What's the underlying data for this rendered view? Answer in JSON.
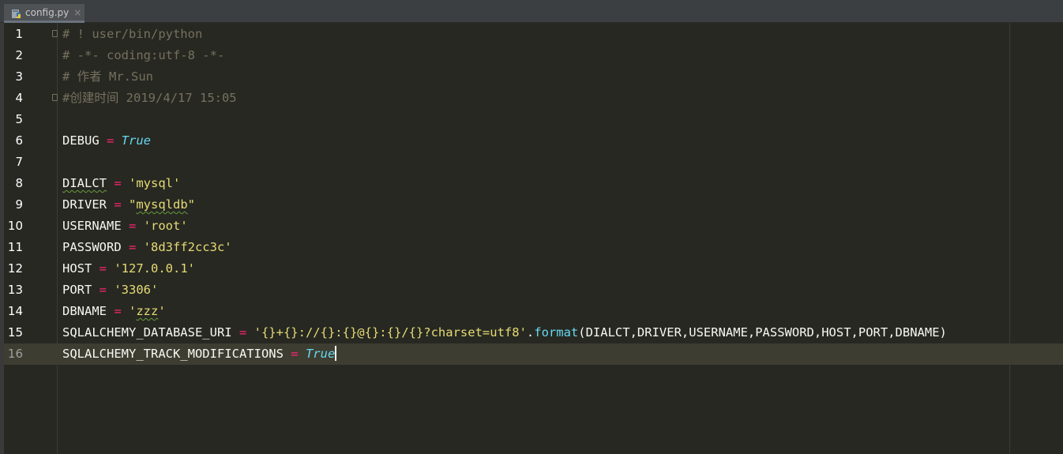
{
  "tab": {
    "label": "config.py",
    "close": "×",
    "icon": "python-file-icon"
  },
  "colors": {
    "background": "#272822",
    "comment": "#75715e",
    "operator": "#f92672",
    "constant": "#66d9ef",
    "string": "#e6db74",
    "text": "#f8f8f2",
    "current_line": "#3e3d32"
  },
  "lines": [
    {
      "n": "1",
      "fold": true,
      "tokens": [
        {
          "t": "# ! user/bin/python",
          "c": "comment"
        }
      ]
    },
    {
      "n": "2",
      "tokens": [
        {
          "t": "# -*- coding:utf-8 -*-",
          "c": "comment"
        }
      ]
    },
    {
      "n": "3",
      "tokens": [
        {
          "t": "# 作者 Mr.Sun",
          "c": "comment"
        }
      ]
    },
    {
      "n": "4",
      "fold": true,
      "tokens": [
        {
          "t": "#创建时间 2019/4/17 15:05",
          "c": "comment"
        }
      ]
    },
    {
      "n": "5",
      "tokens": []
    },
    {
      "n": "6",
      "tokens": [
        {
          "t": "DEBUG",
          "c": "name"
        },
        {
          "t": " = ",
          "c": "op"
        },
        {
          "t": "True",
          "c": "const"
        }
      ]
    },
    {
      "n": "7",
      "tokens": []
    },
    {
      "n": "8",
      "tokens": [
        {
          "t": "DIALCT",
          "c": "name",
          "sq": true
        },
        {
          "t": " = ",
          "c": "op"
        },
        {
          "t": "'mysql'",
          "c": "str"
        }
      ]
    },
    {
      "n": "9",
      "tokens": [
        {
          "t": "DRIVER",
          "c": "name"
        },
        {
          "t": " = ",
          "c": "op"
        },
        {
          "t": "\"",
          "c": "str"
        },
        {
          "t": "mysqldb",
          "c": "str",
          "sq": true
        },
        {
          "t": "\"",
          "c": "str"
        }
      ]
    },
    {
      "n": "10",
      "tokens": [
        {
          "t": "USERNAME",
          "c": "name"
        },
        {
          "t": " = ",
          "c": "op"
        },
        {
          "t": "'root'",
          "c": "str"
        }
      ]
    },
    {
      "n": "11",
      "tokens": [
        {
          "t": "PASSWORD",
          "c": "name"
        },
        {
          "t": " = ",
          "c": "op"
        },
        {
          "t": "'8d3ff2cc3c'",
          "c": "str"
        }
      ]
    },
    {
      "n": "12",
      "tokens": [
        {
          "t": "HOST",
          "c": "name"
        },
        {
          "t": " = ",
          "c": "op"
        },
        {
          "t": "'127.0.0.1'",
          "c": "str"
        }
      ]
    },
    {
      "n": "13",
      "tokens": [
        {
          "t": "PORT",
          "c": "name"
        },
        {
          "t": " = ",
          "c": "op"
        },
        {
          "t": "'3306'",
          "c": "str"
        }
      ]
    },
    {
      "n": "14",
      "tokens": [
        {
          "t": "DBNAME",
          "c": "name"
        },
        {
          "t": " = ",
          "c": "op"
        },
        {
          "t": "'",
          "c": "str"
        },
        {
          "t": "zzz",
          "c": "str",
          "sq": true
        },
        {
          "t": "'",
          "c": "str"
        }
      ]
    },
    {
      "n": "15",
      "tokens": [
        {
          "t": "SQLALCHEMY_DATABASE_URI",
          "c": "name"
        },
        {
          "t": " = ",
          "c": "op"
        },
        {
          "t": "'{}+{}://{}:{}@{}:{}/{}?charset=utf8'",
          "c": "str"
        },
        {
          "t": ".",
          "c": "name"
        },
        {
          "t": "format",
          "c": "fn"
        },
        {
          "t": "(DIALCT,DRIVER,USERNAME,PASSWORD,HOST,PORT,DBNAME)",
          "c": "name"
        }
      ]
    },
    {
      "n": "16",
      "current": true,
      "caret": true,
      "tokens": [
        {
          "t": "SQLALCHEMY_TRACK_MODIFICATIONS",
          "c": "name"
        },
        {
          "t": " = ",
          "c": "op"
        },
        {
          "t": "True",
          "c": "const"
        }
      ]
    }
  ]
}
